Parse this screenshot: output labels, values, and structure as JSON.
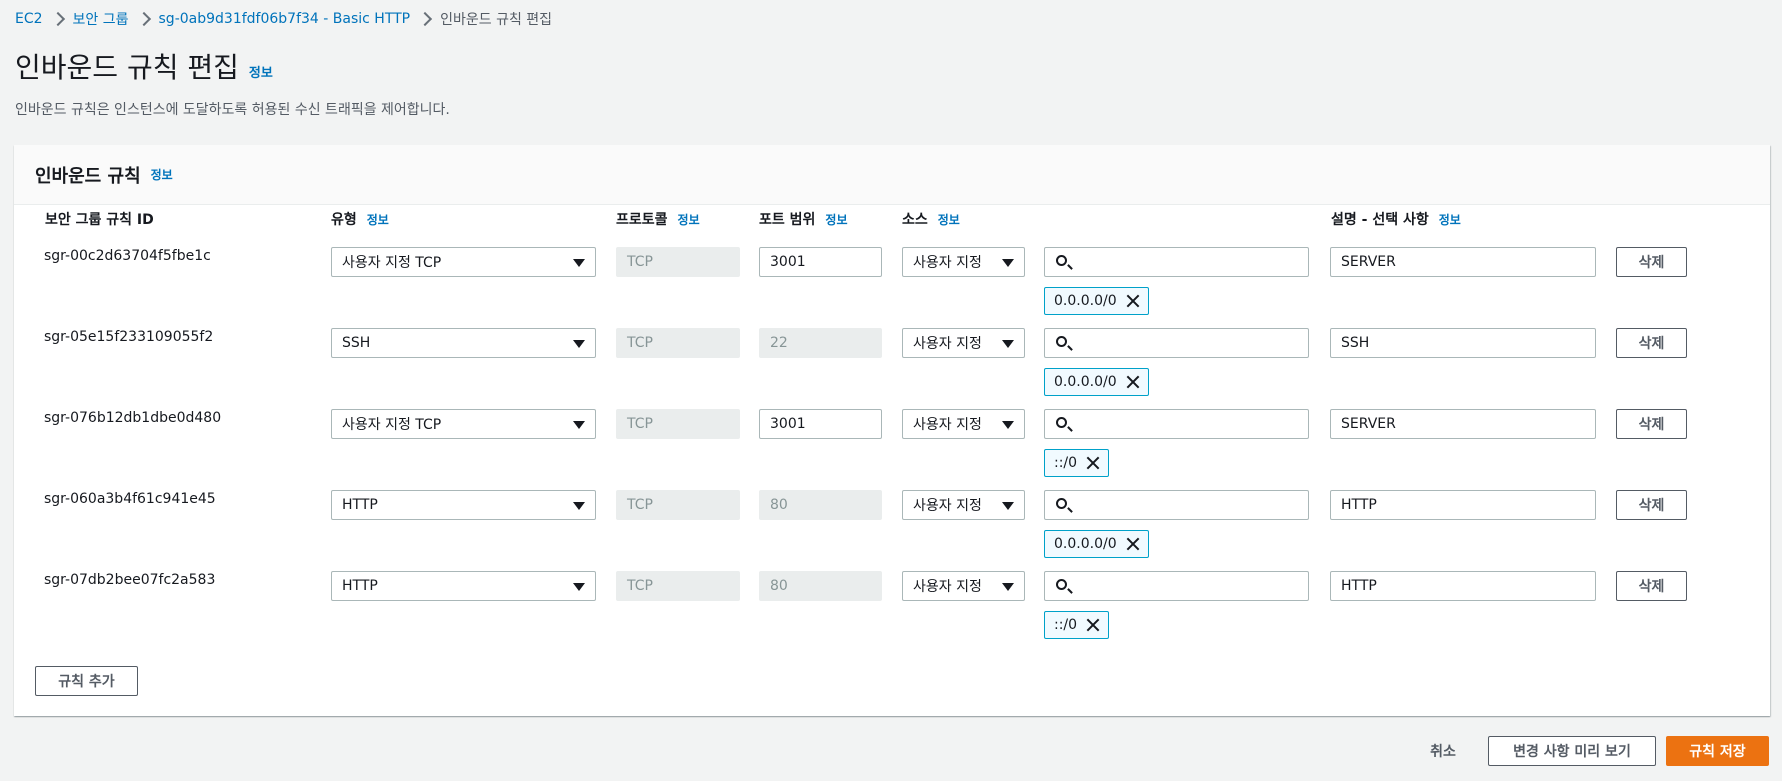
{
  "breadcrumb": [
    "EC2",
    "보안 그룹",
    "sg-0ab9d31fdf06b7f34 - Basic HTTP",
    "인바운드 규칙 편집"
  ],
  "page": {
    "title": "인바운드 규칙 편집",
    "info": "정보",
    "description": "인바운드 규칙은 인스턴스에 도달하도록 허용된 수신 트래픽을 제어합니다."
  },
  "panel": {
    "title": "인바운드 규칙",
    "info": "정보",
    "columns": {
      "rule_id": "보안 그룹 규칙 ID",
      "type": "유형",
      "protocol": "프로토콜",
      "port_range": "포트 범위",
      "source": "소스",
      "description": "설명 - 선택 사항",
      "info": "정보"
    }
  },
  "rules": [
    {
      "id": "sgr-00c2d63704f5fbe1c",
      "type": "사용자 지정 TCP",
      "protocol": "TCP",
      "port": "3001",
      "port_editable": true,
      "source_type": "사용자 지정",
      "search_value": "",
      "cidr": "0.0.0.0/0",
      "description": "SERVER",
      "delete_label": "삭제"
    },
    {
      "id": "sgr-05e15f233109055f2",
      "type": "SSH",
      "protocol": "TCP",
      "port": "22",
      "port_editable": false,
      "source_type": "사용자 지정",
      "search_value": "",
      "cidr": "0.0.0.0/0",
      "description": "SSH",
      "delete_label": "삭제"
    },
    {
      "id": "sgr-076b12db1dbe0d480",
      "type": "사용자 지정 TCP",
      "protocol": "TCP",
      "port": "3001",
      "port_editable": true,
      "source_type": "사용자 지정",
      "search_value": "",
      "cidr": "::/0",
      "description": "SERVER",
      "delete_label": "삭제"
    },
    {
      "id": "sgr-060a3b4f61c941e45",
      "type": "HTTP",
      "protocol": "TCP",
      "port": "80",
      "port_editable": false,
      "source_type": "사용자 지정",
      "search_value": "",
      "cidr": "0.0.0.0/0",
      "description": "HTTP",
      "delete_label": "삭제"
    },
    {
      "id": "sgr-07db2bee07fc2a583",
      "type": "HTTP",
      "protocol": "TCP",
      "port": "80",
      "port_editable": false,
      "source_type": "사용자 지정",
      "search_value": "",
      "cidr": "::/0",
      "description": "HTTP",
      "delete_label": "삭제"
    }
  ],
  "add_rule_label": "규칙 추가",
  "footer": {
    "cancel": "취소",
    "preview": "변경 사항 미리 보기",
    "save": "규칙 저장"
  },
  "colors": {
    "link": "#0073bb",
    "primary": "#ec7211",
    "token_border": "#00a1c9",
    "token_bg": "#f1faff",
    "background": "#f2f3f3"
  },
  "icons": [
    "chevron-right-icon",
    "caret-down-icon",
    "search-icon",
    "close-icon"
  ]
}
